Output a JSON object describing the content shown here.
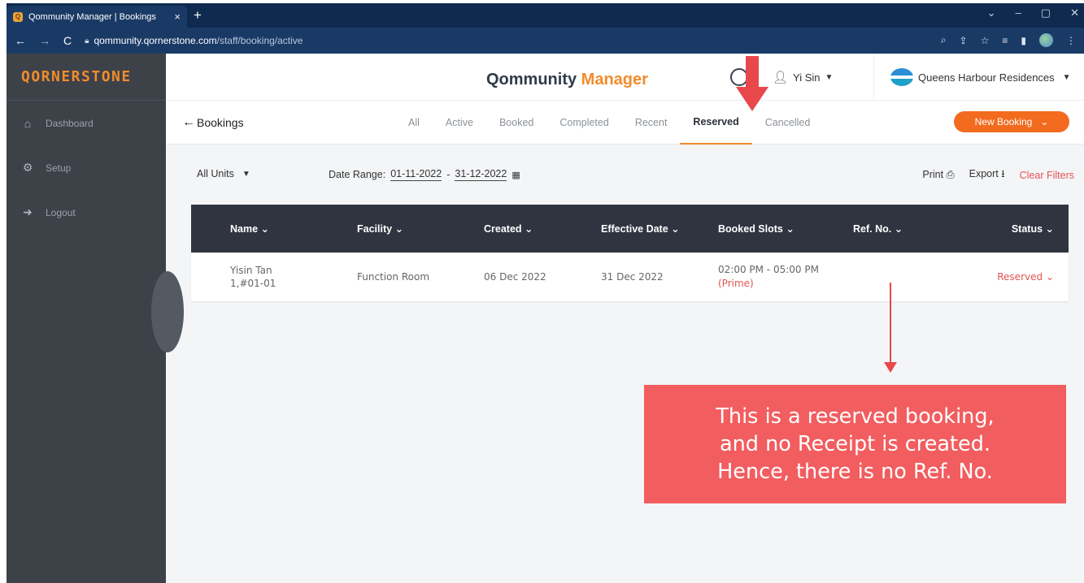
{
  "browser": {
    "tab_title": "Qommunity Manager | Bookings",
    "tab_close": "×",
    "new_tab": "+",
    "url_host": "qommunity.qornerstone.com",
    "url_path": "/staff/booking/active"
  },
  "sidebar": {
    "brand": "QORNERSTONE",
    "items": [
      {
        "label": "Dashboard",
        "icon": "home-icon"
      },
      {
        "label": "Setup",
        "icon": "gear-icon"
      },
      {
        "label": "Logout",
        "icon": "logout-icon"
      }
    ]
  },
  "header": {
    "title_main": "Qommunity ",
    "title_accent": "Manager",
    "user_name": "Yi Sin",
    "org_name": "Queens Harbour Residences"
  },
  "subnav": {
    "back_label": "Bookings",
    "tabs": [
      "All",
      "Active",
      "Booked",
      "Completed",
      "Recent",
      "Reserved",
      "Cancelled"
    ],
    "active_tab": "Reserved",
    "new_booking_label": "New Booking"
  },
  "filters": {
    "units_label": "All Units",
    "date_range_label": "Date Range:",
    "date_from": "01-11-2022",
    "date_sep": "-",
    "date_to": "31-12-2022",
    "print_label": "Print",
    "export_label": "Export",
    "clear_label": "Clear Filters"
  },
  "table": {
    "columns": [
      "Name",
      "Facility",
      "Created",
      "Effective Date",
      "Booked Slots",
      "Ref. No.",
      "Status"
    ],
    "rows": [
      {
        "name": "Yisin Tan",
        "unit": "1,#01-01",
        "facility": "Function Room",
        "created": "06 Dec 2022",
        "effective": "31 Dec 2022",
        "slot": "02:00 PM - 05:00 PM",
        "slot_tag": "(Prime)",
        "ref": "",
        "status": "Reserved"
      }
    ]
  },
  "annotation": {
    "line1": "This is a reserved booking,",
    "line2": "and no Receipt is created.",
    "line3": "Hence, there is no Ref. No.",
    "color": "#f25d5f"
  },
  "colors": {
    "accent": "#f28b2c",
    "sidebar": "#3d4249",
    "table_header": "#2f3440",
    "danger": "#e55353"
  }
}
